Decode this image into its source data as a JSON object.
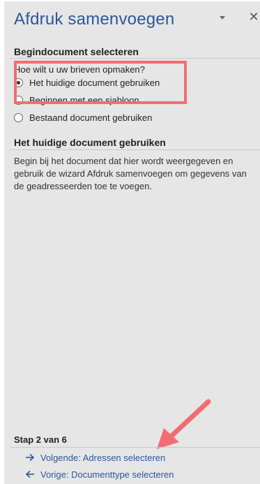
{
  "pane": {
    "title": "Afdruk samenvoegen",
    "close_glyph": "✕",
    "icons": {
      "dropdown": "caret-down-icon",
      "close": "close-icon"
    }
  },
  "select_document": {
    "heading": "Begindocument selecteren",
    "question": "Hoe wilt u uw brieven opmaken?",
    "options": [
      {
        "label": "Het huidige document gebruiken",
        "checked": true
      },
      {
        "label": "Beginnen met een sjabloon",
        "checked": false
      },
      {
        "label": "Bestaand document gebruiken",
        "checked": false
      }
    ]
  },
  "current_document": {
    "heading": "Het huidige document gebruiken",
    "description": "Begin bij het document dat hier wordt weergegeven en gebruik de wizard Afdruk samenvoegen om gegevens van de geadresseerden toe te voegen."
  },
  "footer": {
    "step": "Stap 2 van 6",
    "next_link": "Volgende: Adressen selecteren",
    "prev_link": "Vorige: Documenttype selecteren"
  },
  "colors": {
    "title_blue": "#2b579a",
    "annotation_red": "#f26d73",
    "pane_bg": "#e6e6e6"
  }
}
